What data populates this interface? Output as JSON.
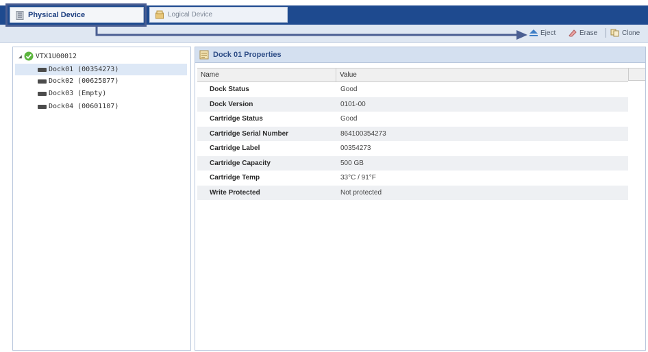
{
  "tabs": [
    {
      "label": "Physical Device",
      "icon": "server-icon",
      "active": true
    },
    {
      "label": "Logical Device",
      "icon": "logical-device-icon",
      "active": false
    }
  ],
  "toolbar": {
    "eject_label": "Eject",
    "erase_label": "Erase",
    "clone_label": "Clone"
  },
  "tree": {
    "root_label": "VTX1U00012",
    "root_status": "ok",
    "items": [
      {
        "label": "Dock01 (00354273)",
        "selected": true
      },
      {
        "label": "Dock02 (00625877)",
        "selected": false
      },
      {
        "label": "Dock03 (Empty)",
        "selected": false
      },
      {
        "label": "Dock04 (00601107)",
        "selected": false
      }
    ]
  },
  "properties": {
    "title": "Dock 01 Properties",
    "columns": [
      "Name",
      "Value"
    ],
    "rows": [
      {
        "name": "Dock Status",
        "value": "Good"
      },
      {
        "name": "Dock Version",
        "value": "0101-00"
      },
      {
        "name": "Cartridge Status",
        "value": "Good"
      },
      {
        "name": "Cartridge Serial Number",
        "value": "864100354273"
      },
      {
        "name": "Cartridge Label",
        "value": "00354273"
      },
      {
        "name": "Cartridge Capacity",
        "value": "500 GB"
      },
      {
        "name": "Cartridge Temp",
        "value": "33°C / 91°F"
      },
      {
        "name": "Write Protected",
        "value": "Not protected"
      }
    ]
  },
  "colors": {
    "tabbar": "#1e4a8f",
    "toolbar": "#dfe7f2",
    "panel_header": "#d4e0f0",
    "selected_row": "#dde8f6",
    "annotation": "#4a5e92"
  }
}
